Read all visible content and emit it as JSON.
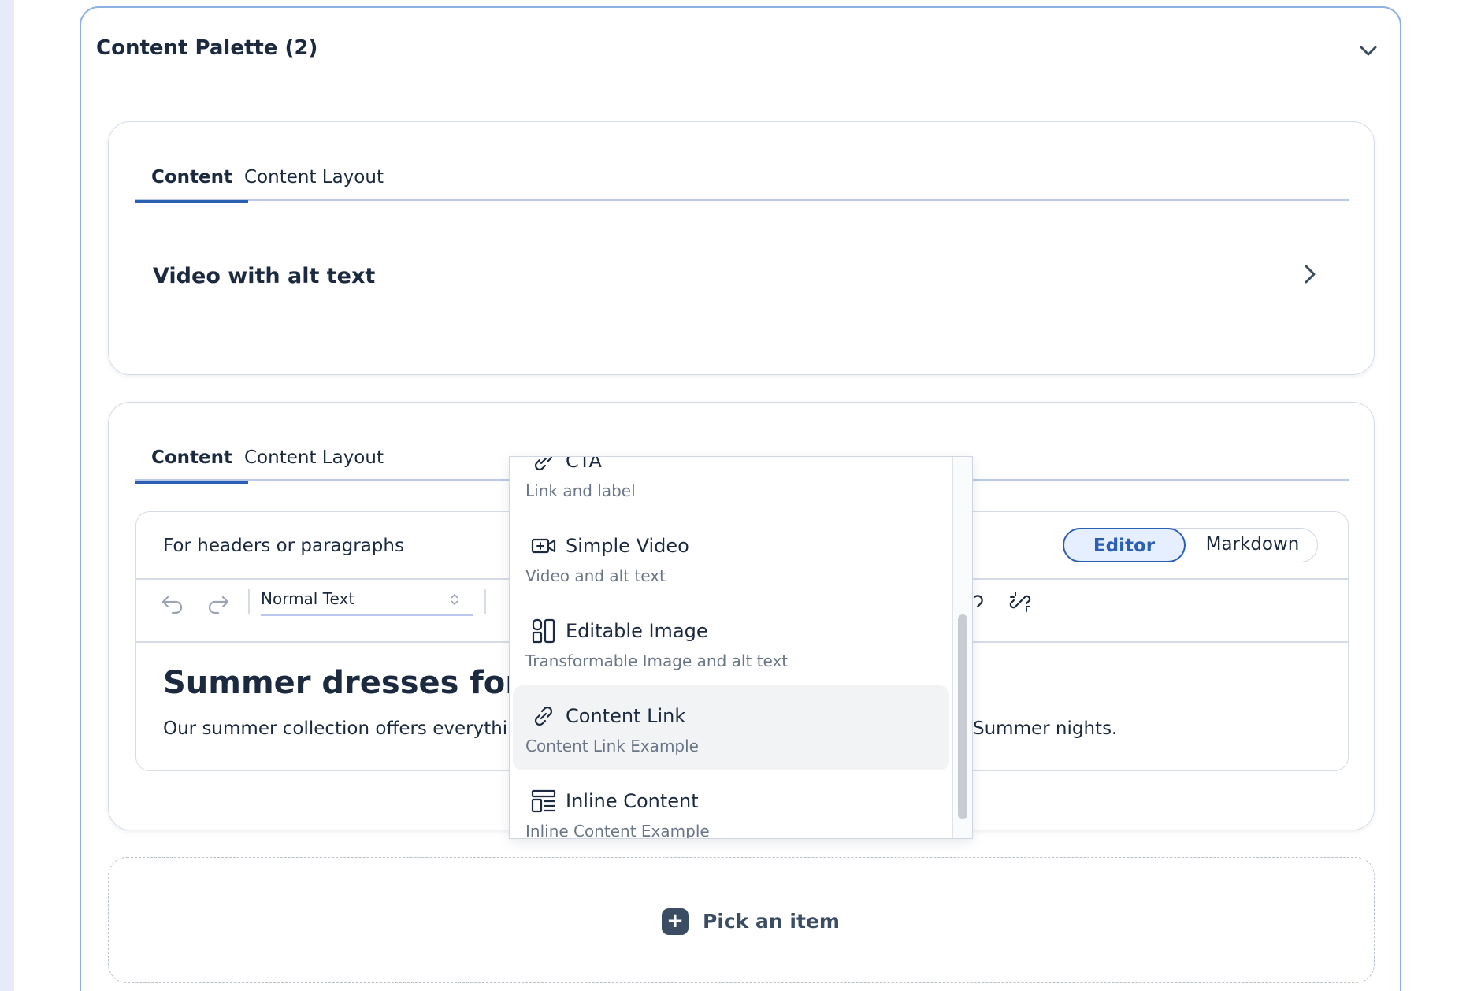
{
  "palette": {
    "title": "Content Palette (2)"
  },
  "card1": {
    "tabs": [
      "Content",
      "Content Layout"
    ],
    "item_title": "Video with alt text"
  },
  "card2": {
    "tabs": [
      "Content",
      "Content Layout"
    ],
    "editor": {
      "label": "For headers or paragraphs",
      "mode_editor": "Editor",
      "mode_markdown": "Markdown",
      "format_select": "Normal Text",
      "heading": "Summer dresses for all",
      "paragraph_left": "Our summer collection offers everything y",
      "paragraph_right": "Summer nights."
    }
  },
  "dropdown": {
    "items": [
      {
        "title": "CTA",
        "subtitle": "Link and label",
        "icon": "link-icon"
      },
      {
        "title": "Simple Video",
        "subtitle": "Video and alt text",
        "icon": "video-plus-icon"
      },
      {
        "title": "Editable Image",
        "subtitle": "Transformable Image and alt text",
        "icon": "editable-image-icon"
      },
      {
        "title": "Content Link",
        "subtitle": "Content Link Example",
        "icon": "link-icon"
      },
      {
        "title": "Inline Content",
        "subtitle": "Inline Content Example",
        "icon": "inline-content-icon"
      }
    ],
    "hovered_index": 3
  },
  "pick": {
    "label": "Pick an item",
    "icon": "plus-icon"
  },
  "colors": {
    "accent": "#2b5fb4",
    "text": "#1b2a3f",
    "border": "#8fb0e2",
    "background": "#e7eaf9"
  }
}
